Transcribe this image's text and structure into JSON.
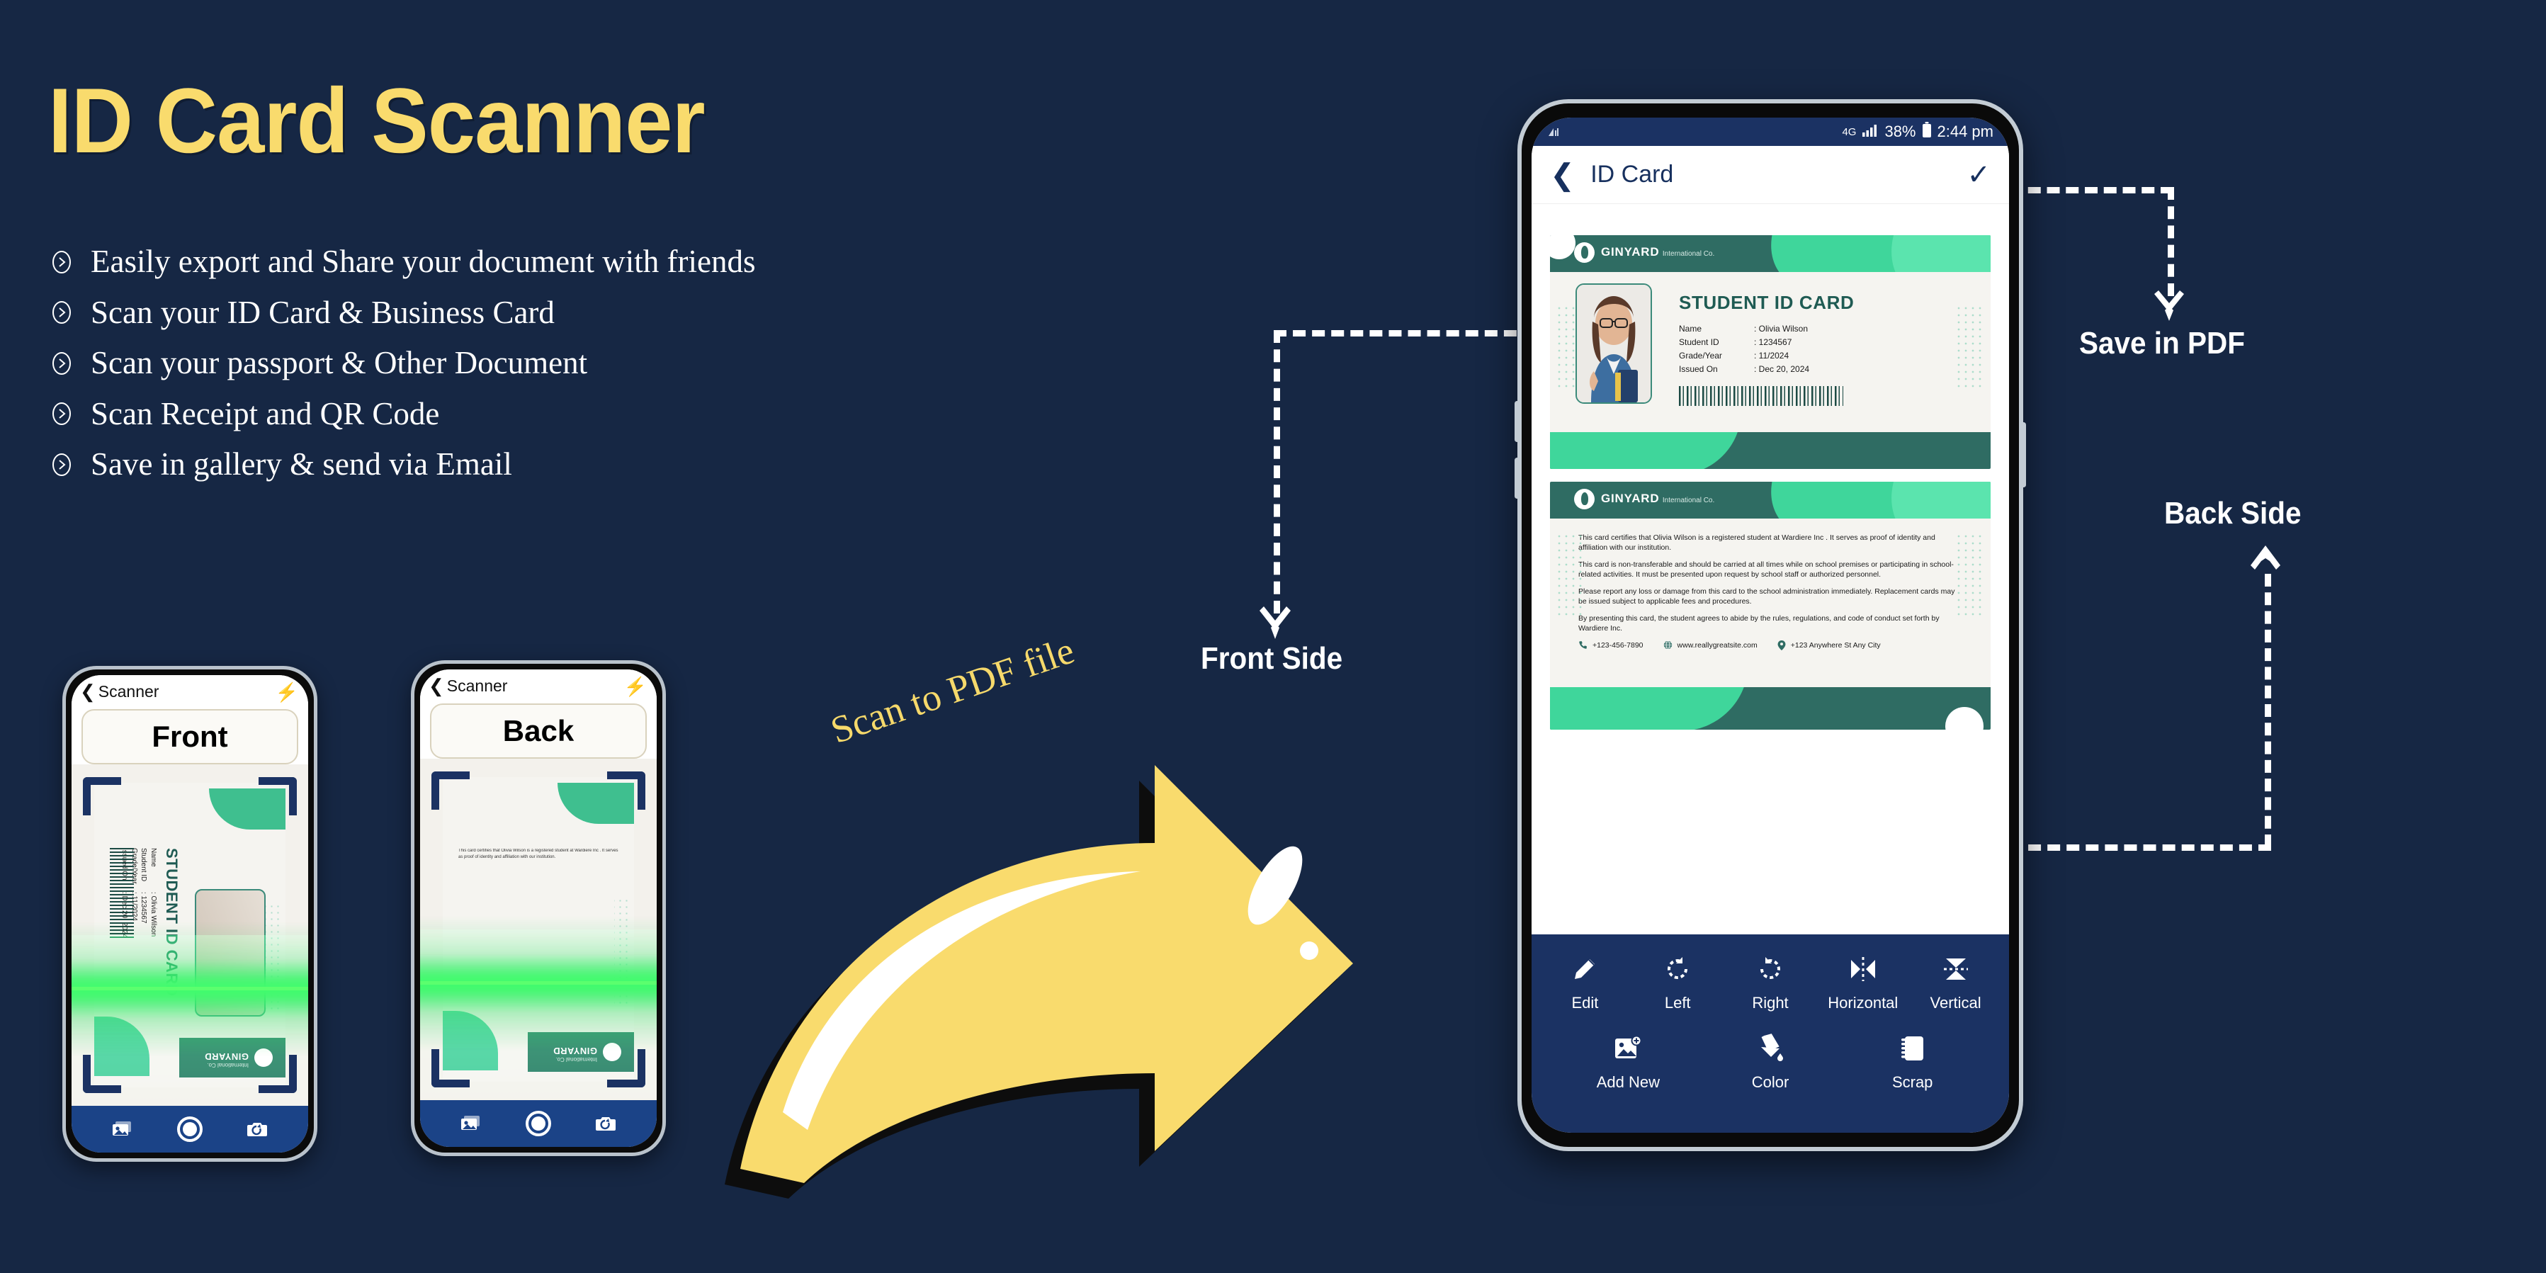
{
  "promo": {
    "title": "ID Card Scanner",
    "features": [
      "Easily export and Share your document with friends",
      "Scan your ID Card  & Business Card",
      "Scan your passport & Other Document",
      "Scan Receipt and QR Code",
      "Save in gallery & send via Email"
    ]
  },
  "mini_phones": [
    {
      "topbar_title": "Scanner",
      "side_label": "Front",
      "back_icon": "chevron-left-icon",
      "flash_icon": "flash-icon",
      "bottom_icons": [
        "gallery-icon",
        "shutter-icon",
        "switch-camera-icon"
      ]
    },
    {
      "topbar_title": "Scanner",
      "side_label": "Back",
      "back_icon": "chevron-left-icon",
      "flash_icon": "flash-icon",
      "bottom_icons": [
        "gallery-icon",
        "shutter-icon",
        "switch-camera-icon"
      ]
    }
  ],
  "mini_card": {
    "title": "STUDENT ID CARD",
    "brand": "GINYARD",
    "brand_sub": "International Co.",
    "rows": [
      {
        "key": "Name",
        "value": ": Olivia Wilson"
      },
      {
        "key": "Student ID",
        "value": ": 1234567"
      },
      {
        "key": "Grade/Year",
        "value": ": 11/2024"
      },
      {
        "key": "Issued On",
        "value": ": Dec 20, 2024"
      }
    ]
  },
  "arrow_label": "Scan to PDF file",
  "annotations": {
    "front_side": "Front Side",
    "save_in_pdf": "Save in PDF",
    "back_side": "Back Side"
  },
  "phone": {
    "status": {
      "network": "4G",
      "signal_icon": "signal-bars-icon",
      "battery_percent": "38%",
      "battery_icon": "battery-icon",
      "time": "2:44 pm",
      "left_icon": "wifi-signal-icon"
    },
    "appbar": {
      "back_icon": "chevron-left-icon",
      "title": "ID Card",
      "confirm_icon": "check-icon"
    },
    "toolbar": {
      "row1": [
        {
          "label": "Edit",
          "icon": "pencil-icon"
        },
        {
          "label": "Left",
          "icon": "rotate-left-icon"
        },
        {
          "label": "Right",
          "icon": "rotate-right-icon"
        },
        {
          "label": "Horizontal",
          "icon": "flip-horizontal-icon"
        },
        {
          "label": "Vertical",
          "icon": "flip-vertical-icon"
        }
      ],
      "row2": [
        {
          "label": "Add New",
          "icon": "add-image-icon"
        },
        {
          "label": "Color",
          "icon": "paint-bucket-icon"
        },
        {
          "label": "Scrap",
          "icon": "scrap-icon"
        }
      ]
    }
  },
  "id_card": {
    "brand": "GINYARD",
    "brand_sub": "International Co.",
    "front": {
      "title": "STUDENT ID CARD",
      "fields": [
        {
          "key": "Name",
          "value": ": Olivia Wilson"
        },
        {
          "key": "Student ID",
          "value": ": 1234567"
        },
        {
          "key": "Grade/Year",
          "value": ": 11/2024"
        },
        {
          "key": "Issued On",
          "value": ": Dec 20, 2024"
        }
      ]
    },
    "back": {
      "paragraphs": [
        "This card certifies that Olivia Wilson is a registered student at Wardiere Inc . It serves as proof of identity and affiliation with our institution.",
        "This card is non-transferable and should be carried at all times while on school premises or participating in school-related activities. It must be presented upon request by school staff or authorized personnel.",
        "Please report any loss or damage from this card to the school administration immediately. Replacement cards may be issued subject to applicable fees and procedures.",
        "By presenting this card, the student agrees to abide by the rules, regulations, and code of conduct set forth by Wardiere Inc."
      ],
      "contacts": [
        {
          "icon": "phone-icon",
          "text": "+123-456-7890"
        },
        {
          "icon": "globe-icon",
          "text": "www.reallygreatsite.com"
        },
        {
          "icon": "location-pin-icon",
          "text": "+123 Anywhere St Any City"
        }
      ]
    }
  },
  "colors": {
    "background": "#162744",
    "title_yellow": "#F9DB6D",
    "phone_blue": "#1B3263",
    "card_teal": "#2F6C63",
    "card_green": "#3FD69B",
    "scan_green": "#5BFF6E"
  }
}
